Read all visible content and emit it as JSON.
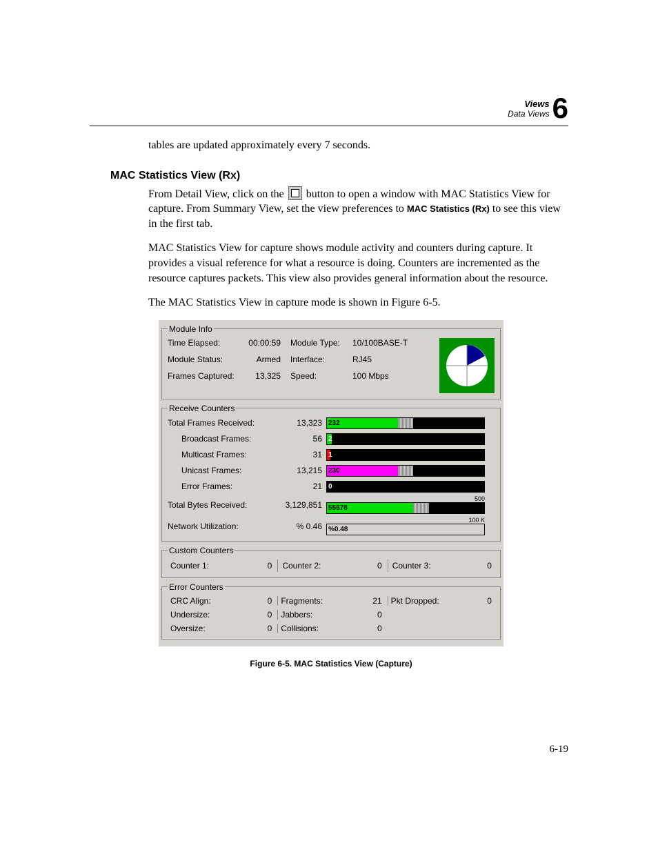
{
  "header": {
    "section": "Views",
    "subsection": "Data Views",
    "chapterNum": "6"
  },
  "intro_line": "tables are updated approximately every 7 seconds.",
  "section_title": "MAC Statistics View (Rx)",
  "para1_a": "From Detail View, click on the ",
  "para1_b": " button to open a window with MAC Statistics View for capture. From Summary View, set the view preferences to ",
  "para1_bold": "MAC Statistics (Rx)",
  "para1_c": " to see this view in the first tab.",
  "para2": "MAC Statistics View for capture shows module activity and counters during capture. It provides a visual reference for what a resource is doing. Counters are incremented as the resource captures packets. This view also provides general information about the resource.",
  "para3": "The MAC Statistics View in capture mode is shown in Figure 6-5.",
  "fig": {
    "module_info": {
      "legend": "Module Info",
      "time_elapsed_l": "Time Elapsed:",
      "time_elapsed_v": "00:00:59",
      "module_status_l": "Module Status:",
      "module_status_v": "Armed",
      "frames_captured_l": "Frames Captured:",
      "frames_captured_v": "13,325",
      "module_type_l": "Module Type:",
      "module_type_v": "10/100BASE-T",
      "interface_l": "Interface:",
      "interface_v": "RJ45",
      "speed_l": "Speed:",
      "speed_v": "100 Mbps"
    },
    "receive": {
      "legend": "Receive Counters",
      "total_frames_l": "Total Frames Received:",
      "total_frames_v": "13,323",
      "total_frames_bar": "232",
      "broadcast_l": "Broadcast Frames:",
      "broadcast_v": "56",
      "broadcast_bar": "2",
      "multicast_l": "Multicast Frames:",
      "multicast_v": "31",
      "multicast_bar": "1",
      "unicast_l": "Unicast Frames:",
      "unicast_v": "13,215",
      "unicast_bar": "230",
      "error_l": "Error Frames:",
      "error_v": "21",
      "error_bar": "0",
      "total_bytes_l": "Total Bytes Received:",
      "total_bytes_v": "3,129,851",
      "total_bytes_bar": "55578",
      "total_bytes_max": "500",
      "netutil_l": "Network Utilization:",
      "netutil_v": "% 0.46",
      "netutil_bar": "%0.48",
      "netutil_max": "100 K"
    },
    "custom": {
      "legend": "Custom Counters",
      "c1_l": "Counter 1:",
      "c1_v": "0",
      "c2_l": "Counter 2:",
      "c2_v": "0",
      "c3_l": "Counter 3:",
      "c3_v": "0"
    },
    "error": {
      "legend": "Error Counters",
      "crc_l": "CRC Align:",
      "crc_v": "0",
      "under_l": "Undersize:",
      "under_v": "0",
      "over_l": "Oversize:",
      "over_v": "0",
      "frag_l": "Fragments:",
      "frag_v": "21",
      "jab_l": "Jabbers:",
      "jab_v": "0",
      "coll_l": "Collisions:",
      "coll_v": "0",
      "pkt_l": "Pkt Dropped:",
      "pkt_v": "0"
    }
  },
  "figcaption": "Figure 6-5.  MAC Statistics View (Capture)",
  "pageno": "6-19"
}
